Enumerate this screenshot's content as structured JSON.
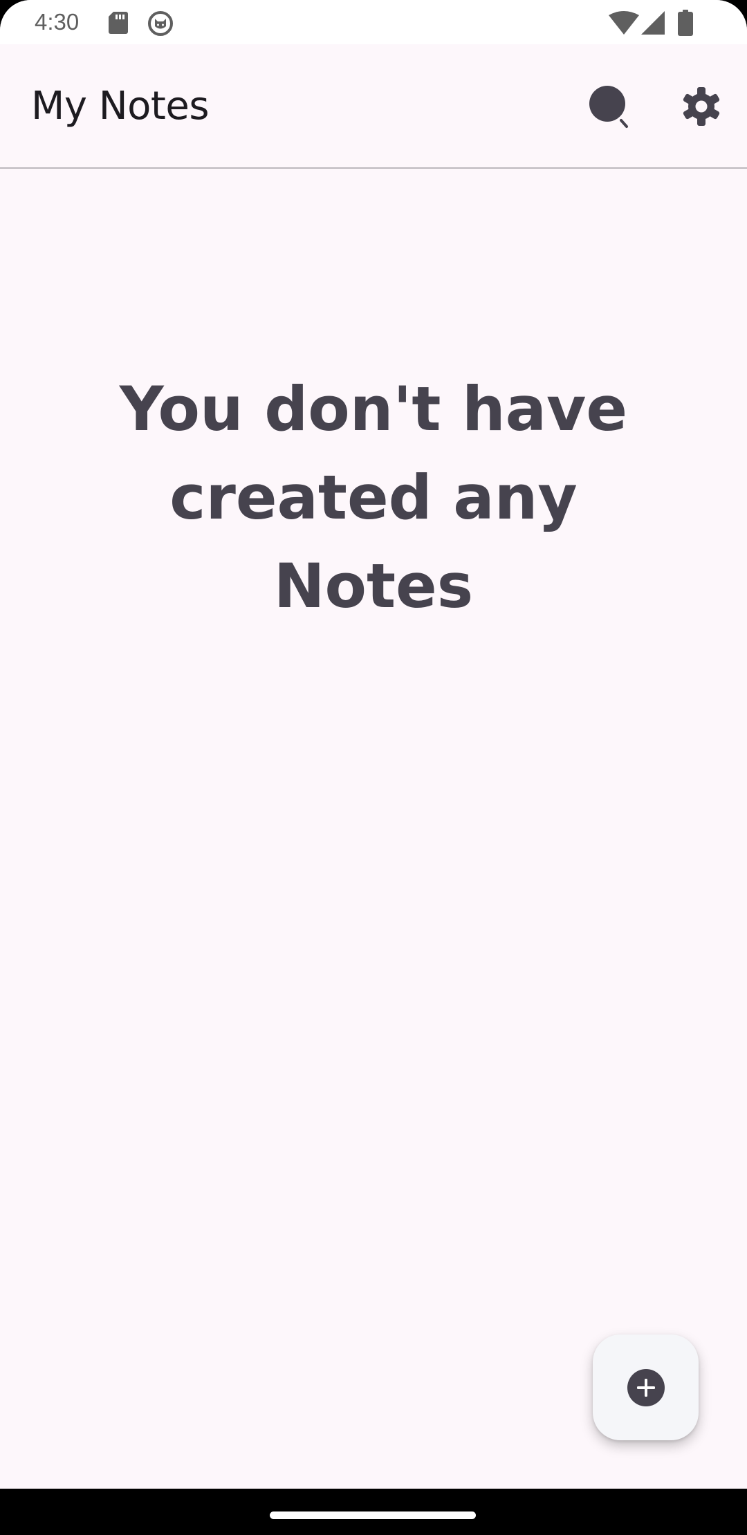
{
  "status_bar": {
    "time": "4:30",
    "icons": [
      "sd-card-icon",
      "cat-face-icon",
      "wifi-icon",
      "cellular-signal-icon",
      "battery-icon"
    ]
  },
  "app_bar": {
    "title": "My Notes",
    "actions": [
      "search-icon",
      "settings-icon"
    ]
  },
  "main": {
    "empty_message": "You don't have created any Notes"
  },
  "fab": {
    "icon": "add-circle-icon"
  },
  "colors": {
    "background": "#fdf7fb",
    "title_text": "#1d1b20",
    "empty_text": "#46434e",
    "icon": "#46434e",
    "fab_surface": "#f5f6f9"
  }
}
